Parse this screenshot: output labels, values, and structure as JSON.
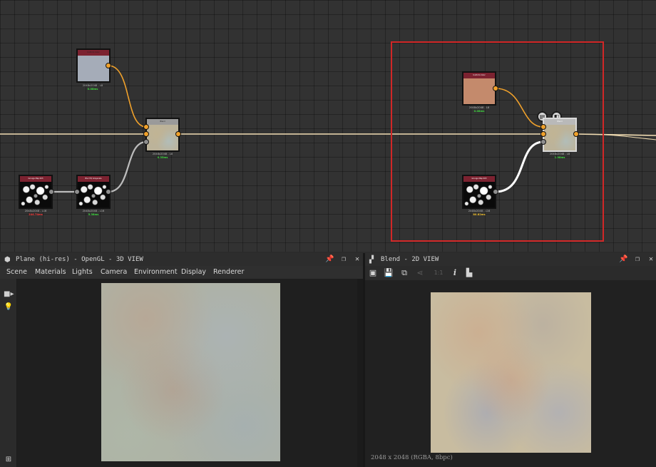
{
  "graph": {
    "nodes": {
      "uniform_color_1": {
        "title": "Uniform Color",
        "resolution": "2048x2048 - L8",
        "time": "0.08ms",
        "time_color": "#3fdc3f",
        "swatch": "#a5acb8"
      },
      "blend_1": {
        "title": "Blend",
        "resolution": "2048x2048 - L8",
        "time": "0.35ms",
        "time_color": "#3fdc3f"
      },
      "grunge_map_1": {
        "title": "Grunge Map 003",
        "resolution": "2048x2048 - L16",
        "time": "244.74ms",
        "time_color": "#ff3b3b"
      },
      "blur_hq_1": {
        "title": "Blur HQ Grayscale",
        "resolution": "2048x2048 - L16",
        "time": "5.38ms",
        "time_color": "#3fdc3f"
      },
      "uniform_color_2": {
        "title": "Uniform Color",
        "resolution": "2048x2048 - L8",
        "time": "0.08ms",
        "time_color": "#3fdc3f",
        "swatch": "#c48a6c"
      },
      "blend_2": {
        "title": "Blend",
        "resolution": "2048x2048 - L8",
        "time": "1.98ms",
        "time_color": "#3fdc3f"
      },
      "grunge_map_2": {
        "title": "Grunge Map 003",
        "resolution": "2048x2048 - L16",
        "time": "80.82ms",
        "time_color": "#f2c12e"
      }
    },
    "wire_colors": {
      "orange": "#f0a12b",
      "white": "#e6e6e6",
      "grey": "#9a9a9a",
      "cream": "#f3deb3"
    },
    "frame_color": "#d12727"
  },
  "panel3d": {
    "title": "Plane (hi-res) - OpenGL - 3D VIEW",
    "icon": "cube-icon",
    "menu": [
      "Scene",
      "Materials",
      "Lights",
      "Camera",
      "Environment",
      "Display",
      "Renderer"
    ],
    "sidebar_icons": [
      "camera-icon",
      "lightbulb-icon",
      "hierarchy-icon"
    ]
  },
  "panel2d": {
    "title": "Blend - 2D VIEW",
    "icon": "checker-icon",
    "toolbar_icons": [
      "display-icon",
      "save-icon",
      "copy-icon",
      "share-icon",
      "zoom-icon",
      "info-icon",
      "histogram-icon"
    ],
    "zoom_label": "1:1",
    "info": "2048 x 2048 (RGBA, 8bpc)"
  }
}
